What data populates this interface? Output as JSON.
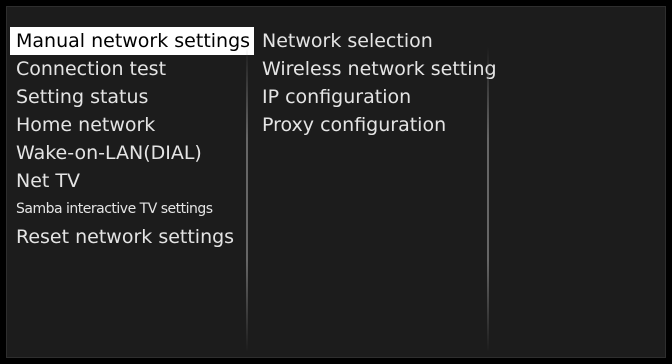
{
  "menu": {
    "items": [
      {
        "label": "Manual network settings"
      },
      {
        "label": "Connection test"
      },
      {
        "label": "Setting status"
      },
      {
        "label": "Home network"
      },
      {
        "label": "Wake-on-LAN(DIAL)"
      },
      {
        "label": "Net TV"
      },
      {
        "label": "Samba interactive TV settings"
      },
      {
        "label": "Reset network settings"
      }
    ],
    "selected_index": 0
  },
  "submenu": {
    "items": [
      {
        "label": "Network selection"
      },
      {
        "label": "Wireless network setting"
      },
      {
        "label": "IP configuration"
      },
      {
        "label": "Proxy configuration"
      }
    ]
  },
  "colors": {
    "background": "#000000",
    "panel": "#1c1c1c",
    "text": "#e4e4e4",
    "highlight": "#ffffff",
    "highlight_text": "#000000"
  }
}
